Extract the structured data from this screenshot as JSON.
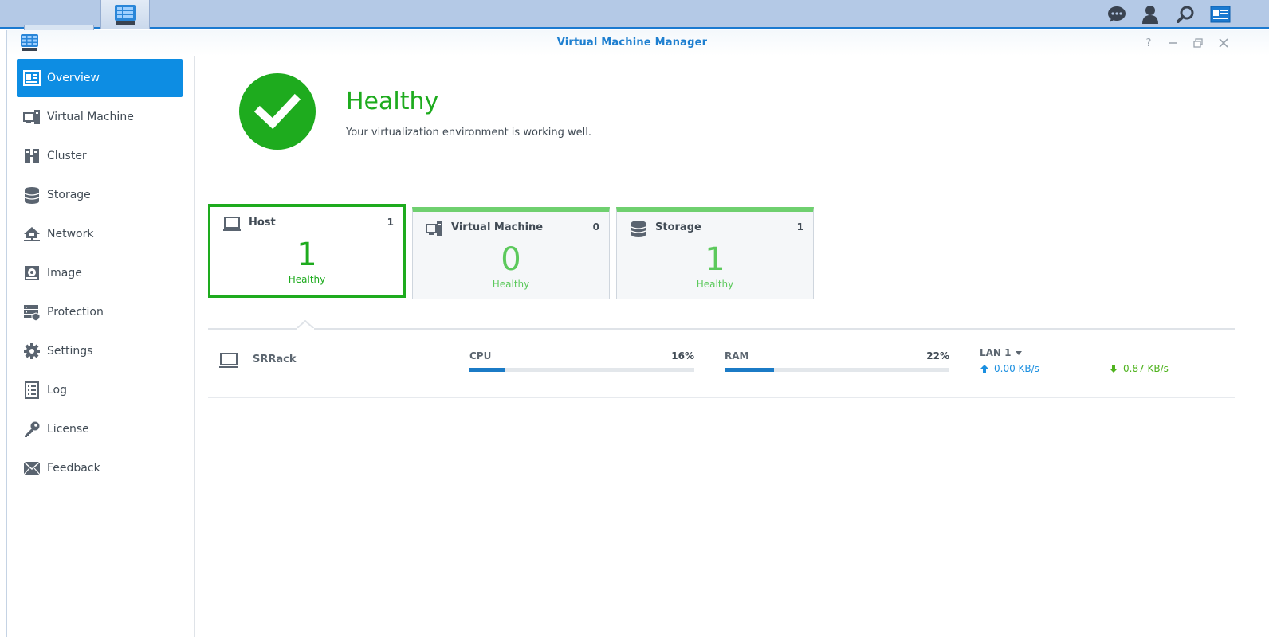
{
  "window": {
    "title": "Virtual Machine Manager"
  },
  "sidebar": {
    "items": [
      {
        "label": "Overview",
        "icon": "overview-icon",
        "active": true
      },
      {
        "label": "Virtual Machine",
        "icon": "virtual-machine-icon"
      },
      {
        "label": "Cluster",
        "icon": "cluster-icon"
      },
      {
        "label": "Storage",
        "icon": "storage-icon"
      },
      {
        "label": "Network",
        "icon": "network-icon"
      },
      {
        "label": "Image",
        "icon": "image-icon"
      },
      {
        "label": "Protection",
        "icon": "protection-icon"
      },
      {
        "label": "Settings",
        "icon": "gear-icon"
      },
      {
        "label": "Log",
        "icon": "log-icon"
      },
      {
        "label": "License",
        "icon": "key-icon"
      },
      {
        "label": "Feedback",
        "icon": "envelope-icon"
      }
    ]
  },
  "health": {
    "title": "Healthy",
    "description": "Your virtualization environment is working well."
  },
  "cards": [
    {
      "label": "Host",
      "count": "1",
      "big": "1",
      "status": "Healthy",
      "selected": true
    },
    {
      "label": "Virtual Machine",
      "count": "0",
      "big": "0",
      "status": "Healthy",
      "selected": false
    },
    {
      "label": "Storage",
      "count": "1",
      "big": "1",
      "status": "Healthy",
      "selected": false
    }
  ],
  "host": {
    "name": "SRRack",
    "cpu": {
      "label": "CPU",
      "value": "16%",
      "fraction": 0.16
    },
    "ram": {
      "label": "RAM",
      "value": "22%",
      "fraction": 0.22
    },
    "lan": {
      "label": "LAN 1",
      "upload": "0.00 KB/s",
      "download": "0.87 KB/s"
    }
  },
  "colors": {
    "accent": "#0d8de3",
    "healthy": "#1eab1e",
    "healthy_light": "#5cc95c",
    "bar": "#1b7bc6"
  }
}
